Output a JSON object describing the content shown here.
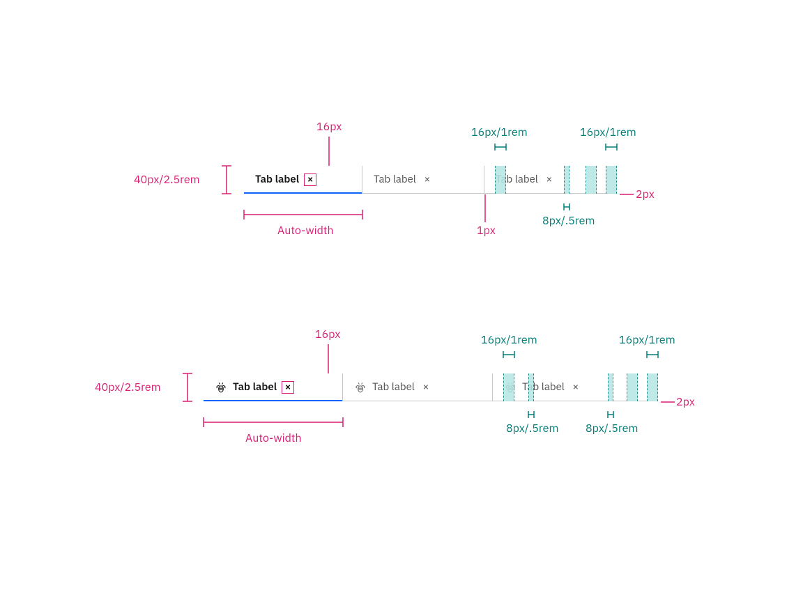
{
  "measurements": {
    "height": "40px/2.5rem",
    "icon_size": "16px",
    "padding_16": "16px/1rem",
    "gap_8": "8px/.5rem",
    "underline": "2px",
    "divider": "1px",
    "auto_width": "Auto-width"
  },
  "example1": {
    "tabs": [
      {
        "label": "Tab label",
        "selected": true,
        "dismissible": true
      },
      {
        "label": "Tab label",
        "selected": false,
        "dismissible": true
      },
      {
        "label": "Tab label",
        "selected": false,
        "dismissible": true
      }
    ]
  },
  "example2": {
    "tabs": [
      {
        "label": "Tab label",
        "selected": true,
        "dismissible": true,
        "icon": "bee"
      },
      {
        "label": "Tab label",
        "selected": false,
        "dismissible": true,
        "icon": "bee"
      },
      {
        "label": "Tab label",
        "selected": false,
        "dismissible": true,
        "icon": "bee"
      }
    ]
  }
}
